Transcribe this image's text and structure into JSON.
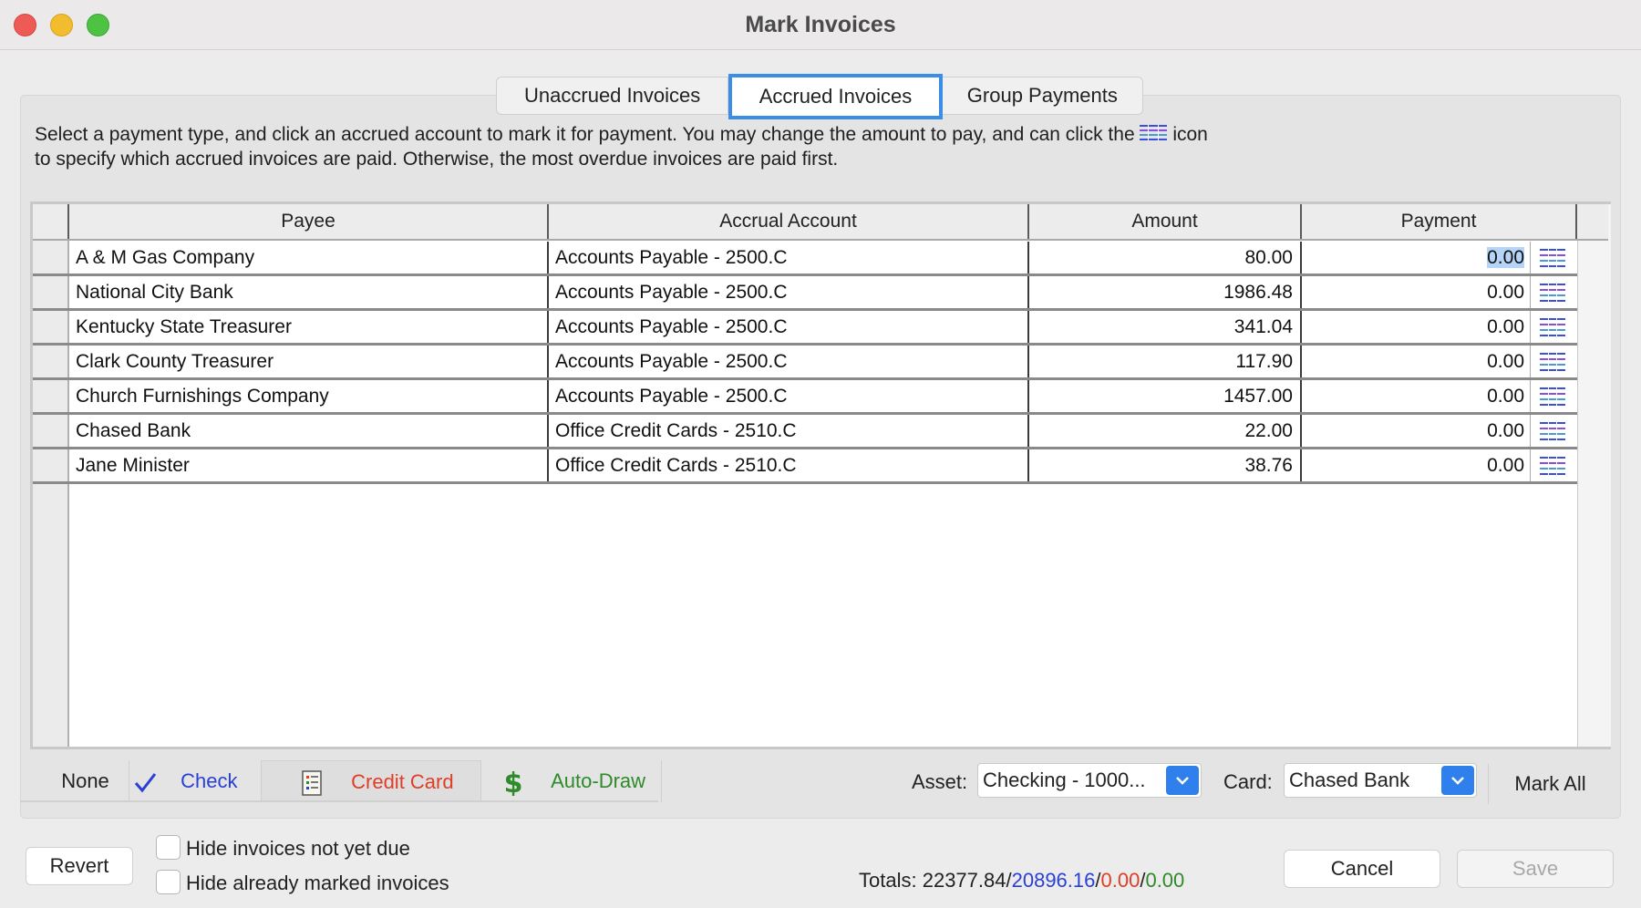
{
  "window": {
    "title": "Mark Invoices"
  },
  "tabs": [
    {
      "label": "Unaccrued Invoices"
    },
    {
      "label": "Accrued Invoices"
    },
    {
      "label": "Group Payments"
    }
  ],
  "instructions": {
    "line1_a": "Select a payment type, and click an accrued account to mark it for payment. You may change the amount to pay, and can click the",
    "line1_b": "icon",
    "line2": "to specify which accrued invoices are paid. Otherwise, the most overdue invoices are paid first."
  },
  "table": {
    "columns": [
      "Payee",
      "Accrual Account",
      "Amount",
      "Payment"
    ],
    "rows": [
      {
        "payee": "A & M Gas Company",
        "account": "Accounts Payable - 2500.C",
        "amount": "80.00",
        "payment": "0.00"
      },
      {
        "payee": "National City Bank",
        "account": "Accounts Payable - 2500.C",
        "amount": "1986.48",
        "payment": "0.00"
      },
      {
        "payee": "Kentucky State Treasurer",
        "account": "Accounts Payable - 2500.C",
        "amount": "341.04",
        "payment": "0.00"
      },
      {
        "payee": "Clark County Treasurer",
        "account": "Accounts Payable - 2500.C",
        "amount": "117.90",
        "payment": "0.00"
      },
      {
        "payee": "Church Furnishings Company",
        "account": "Accounts Payable - 2500.C",
        "amount": "1457.00",
        "payment": "0.00"
      },
      {
        "payee": "Chased Bank",
        "account": "Office Credit Cards - 2510.C",
        "amount": "22.00",
        "payment": "0.00"
      },
      {
        "payee": "Jane Minister",
        "account": "Office Credit Cards - 2510.C",
        "amount": "38.76",
        "payment": "0.00"
      }
    ]
  },
  "payment_types": {
    "none": "None",
    "check": "Check",
    "credit_card": "Credit Card",
    "auto_draw": "Auto-Draw",
    "check_icon": "checkmark-icon",
    "credit_card_icon": "credit-card-icon",
    "auto_draw_icon": "dollar-icon"
  },
  "asset": {
    "label": "Asset:",
    "value": "Checking - 1000..."
  },
  "card": {
    "label": "Card:",
    "value": "Chased Bank"
  },
  "buttons": {
    "mark_all": "Mark All",
    "revert": "Revert",
    "cancel": "Cancel",
    "save": "Save"
  },
  "filters": {
    "hide_not_due": "Hide invoices not yet due",
    "hide_marked": "Hide already marked invoices"
  },
  "totals": {
    "label": "Totals:",
    "total": "22377.84",
    "check": "20896.16",
    "credit": "0.00",
    "auto": "0.00",
    "slash": "/"
  },
  "colors": {
    "accent": "#2f80ec",
    "check": "#2a3fd6",
    "credit_card": "#e13d26",
    "auto_draw": "#2e8a2a"
  }
}
